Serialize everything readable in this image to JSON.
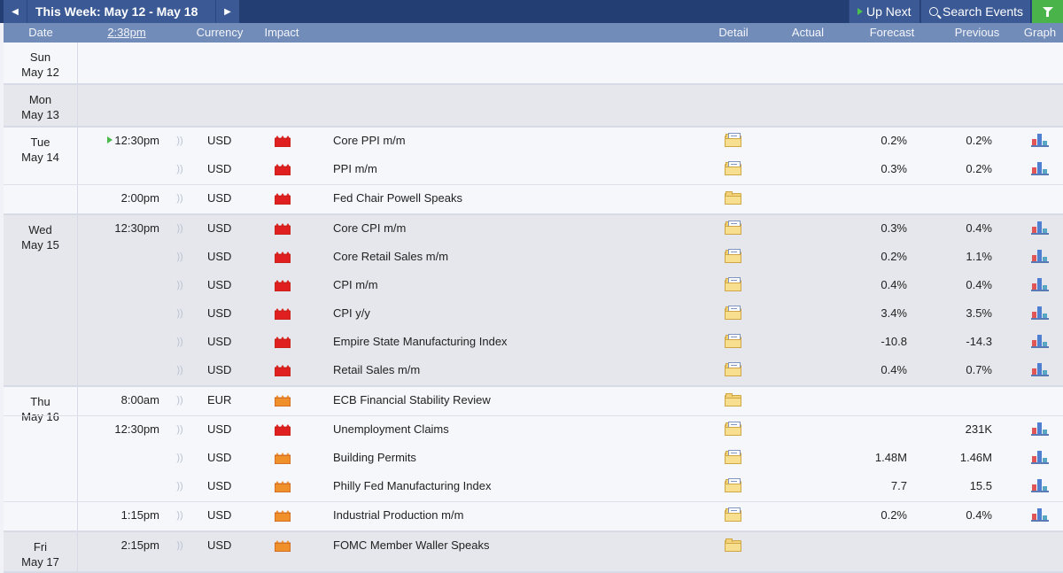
{
  "topbar": {
    "week_label": "This Week: May 12 - May 18",
    "up_next": "Up Next",
    "search_events": "Search Events"
  },
  "columns": {
    "date": "Date",
    "time": "2:38pm",
    "currency": "Currency",
    "impact": "Impact",
    "detail": "Detail",
    "actual": "Actual",
    "forecast": "Forecast",
    "previous": "Previous",
    "graph": "Graph"
  },
  "colors": {
    "impact_high": "#e02020",
    "impact_medium": "#f0902a",
    "header_bar": "#233e72",
    "column_bar": "#728cb9"
  },
  "days": [
    {
      "day": "Sun",
      "date": "May 12",
      "events": []
    },
    {
      "day": "Mon",
      "date": "May 13",
      "events": []
    },
    {
      "day": "Tue",
      "date": "May 14",
      "events": [
        {
          "time": "12:30pm",
          "currency": "USD",
          "impact": "high",
          "title": "Core PPI m/m",
          "actual": "",
          "forecast": "0.2%",
          "previous": "0.2%"
        },
        {
          "time": "",
          "currency": "USD",
          "impact": "high",
          "title": "PPI m/m",
          "actual": "",
          "forecast": "0.3%",
          "previous": "0.2%"
        },
        {
          "time": "2:00pm",
          "currency": "USD",
          "impact": "high",
          "title": "Fed Chair Powell Speaks",
          "actual": "",
          "forecast": "",
          "previous": ""
        }
      ]
    },
    {
      "day": "Wed",
      "date": "May 15",
      "events": [
        {
          "time": "12:30pm",
          "currency": "USD",
          "impact": "high",
          "title": "Core CPI m/m",
          "actual": "",
          "forecast": "0.3%",
          "previous": "0.4%"
        },
        {
          "time": "",
          "currency": "USD",
          "impact": "high",
          "title": "Core Retail Sales m/m",
          "actual": "",
          "forecast": "0.2%",
          "previous": "1.1%"
        },
        {
          "time": "",
          "currency": "USD",
          "impact": "high",
          "title": "CPI m/m",
          "actual": "",
          "forecast": "0.4%",
          "previous": "0.4%"
        },
        {
          "time": "",
          "currency": "USD",
          "impact": "high",
          "title": "CPI y/y",
          "actual": "",
          "forecast": "3.4%",
          "previous": "3.5%"
        },
        {
          "time": "",
          "currency": "USD",
          "impact": "high",
          "title": "Empire State Manufacturing Index",
          "actual": "",
          "forecast": "-10.8",
          "previous": "-14.3"
        },
        {
          "time": "",
          "currency": "USD",
          "impact": "high",
          "title": "Retail Sales m/m",
          "actual": "",
          "forecast": "0.4%",
          "previous": "0.7%"
        }
      ]
    },
    {
      "day": "Thu",
      "date": "May 16",
      "events": [
        {
          "time": "8:00am",
          "currency": "EUR",
          "impact": "medium",
          "title": "ECB Financial Stability Review",
          "actual": "",
          "forecast": "",
          "previous": ""
        },
        {
          "time": "12:30pm",
          "currency": "USD",
          "impact": "high",
          "title": "Unemployment Claims",
          "actual": "",
          "forecast": "",
          "previous": "231K"
        },
        {
          "time": "",
          "currency": "USD",
          "impact": "medium",
          "title": "Building Permits",
          "actual": "",
          "forecast": "1.48M",
          "previous": "1.46M"
        },
        {
          "time": "",
          "currency": "USD",
          "impact": "medium",
          "title": "Philly Fed Manufacturing Index",
          "actual": "",
          "forecast": "7.7",
          "previous": "15.5"
        },
        {
          "time": "1:15pm",
          "currency": "USD",
          "impact": "medium",
          "title": "Industrial Production m/m",
          "actual": "",
          "forecast": "0.2%",
          "previous": "0.4%"
        }
      ]
    },
    {
      "day": "Fri",
      "date": "May 17",
      "events": [
        {
          "time": "2:15pm",
          "currency": "USD",
          "impact": "medium",
          "title": "FOMC Member Waller Speaks",
          "actual": "",
          "forecast": "",
          "previous": ""
        }
      ]
    }
  ]
}
